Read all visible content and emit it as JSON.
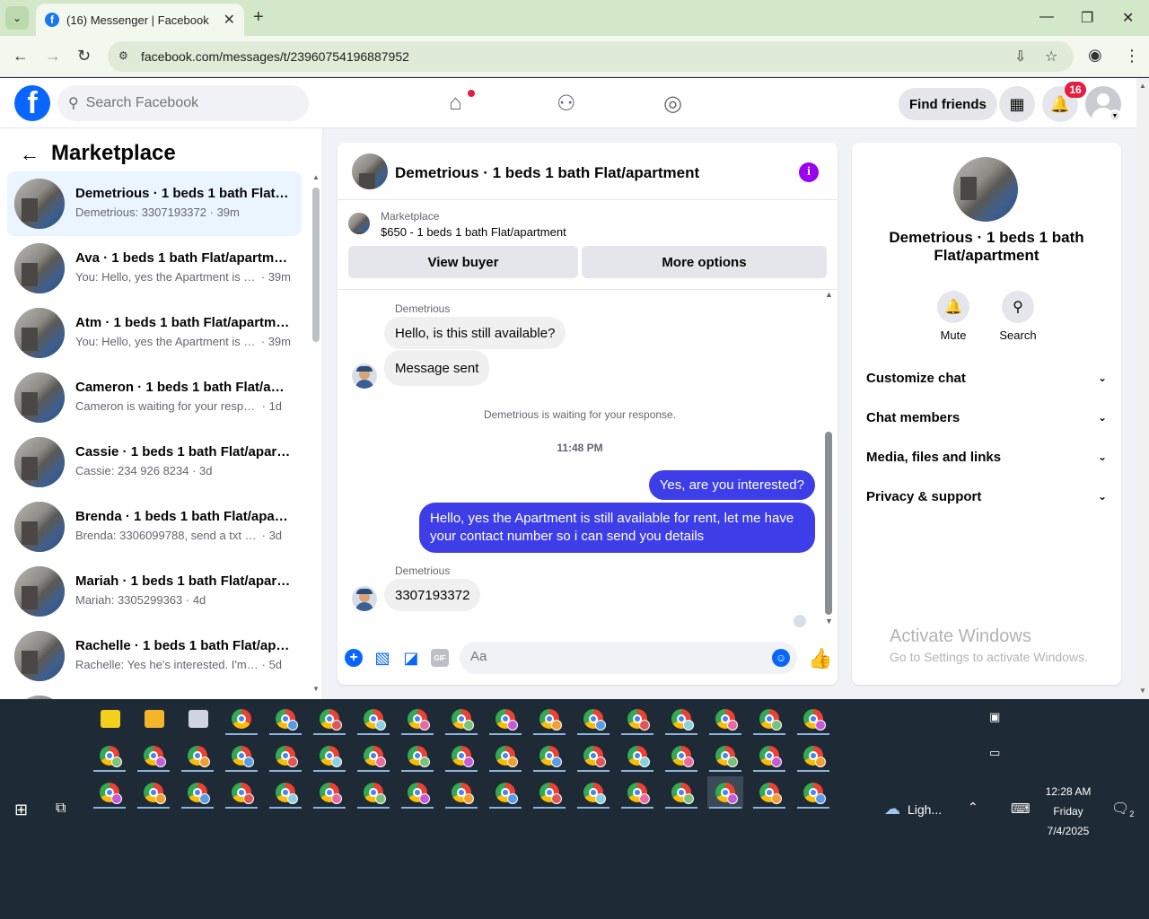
{
  "browser": {
    "tab_title": "(16) Messenger | Facebook",
    "url": "facebook.com/messages/t/23960754196887952"
  },
  "header": {
    "search_placeholder": "Search Facebook",
    "find_friends": "Find friends",
    "notification_count": "16"
  },
  "sidebar": {
    "title": "Marketplace",
    "conversations": [
      {
        "name": "Demetrious · 1 beds 1 bath Flat/apartment",
        "preview": "Demetrious: 3307193372",
        "time": "39m"
      },
      {
        "name": "Ava · 1 beds 1 bath Flat/apartment",
        "preview": "You: Hello, yes the Apartment is s...",
        "time": "39m"
      },
      {
        "name": "Atm · 1 beds 1 bath Flat/apartment",
        "preview": "You: Hello, yes the Apartment is s...",
        "time": "39m"
      },
      {
        "name": "Cameron · 1 beds 1 bath Flat/apartment",
        "preview": "Cameron is waiting for your respon...",
        "time": "1d"
      },
      {
        "name": "Cassie · 1 beds 1 bath Flat/apartment",
        "preview": "Cassie: 234 926 8234",
        "time": "3d"
      },
      {
        "name": "Brenda · 1 beds 1 bath Flat/apartment",
        "preview": "Brenda: 3306099788, send a txt bc...",
        "time": "3d"
      },
      {
        "name": "Mariah · 1 beds 1 bath Flat/apartment",
        "preview": "Mariah: 3305299363",
        "time": "4d"
      },
      {
        "name": "Rachelle · 1 beds 1 bath Flat/apartment",
        "preview": "Rachelle: Yes he's interested. I'm he...",
        "time": "5d"
      }
    ]
  },
  "chat": {
    "title": "Demetrious · 1 beds 1 bath Flat/apartment",
    "listing_label": "Marketplace",
    "listing_title": "$650 - 1 beds 1 bath Flat/apartment",
    "view_buyer": "View buyer",
    "more_options": "More options",
    "messages": {
      "sender1": "Demetrious",
      "in1": "Hello, is this still available?",
      "in2": "Message sent",
      "system": "Demetrious is waiting for your response.",
      "time": "11:48 PM",
      "out1": "Yes, are you interested?",
      "out2": "Hello, yes the Apartment is still available for rent, let me have your contact number so i can send you details",
      "sender2": "Demetrious",
      "in3": "3307193372"
    },
    "composer_placeholder": "Aa"
  },
  "info_panel": {
    "title": "Demetrious · 1 beds 1 bath Flat/apartment",
    "mute": "Mute",
    "search": "Search",
    "rows": [
      "Customize chat",
      "Chat members",
      "Media, files and links",
      "Privacy & support"
    ],
    "watermark_title": "Activate Windows",
    "watermark_sub": "Go to Settings to activate Windows."
  },
  "taskbar": {
    "weather": "Ligh...",
    "time": "12:28 AM",
    "day": "Friday",
    "date": "7/4/2025",
    "notif_count": "2"
  },
  "colors": {
    "facebook_blue": "#0866ff",
    "outgoing_bubble": "#3d3ee8",
    "badge_red": "#e41e3f",
    "info_purple": "#9b00f0"
  }
}
